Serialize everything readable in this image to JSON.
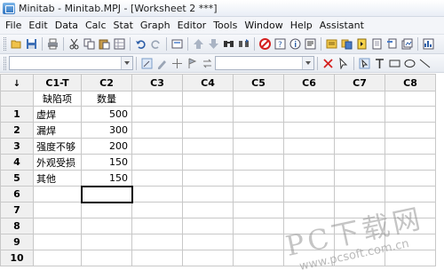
{
  "window": {
    "title": "Minitab - Minitab.MPJ - [Worksheet 2 ***]"
  },
  "menu": [
    {
      "label": "File"
    },
    {
      "label": "Edit"
    },
    {
      "label": "Data"
    },
    {
      "label": "Calc"
    },
    {
      "label": "Stat"
    },
    {
      "label": "Graph"
    },
    {
      "label": "Editor"
    },
    {
      "label": "Tools"
    },
    {
      "label": "Window"
    },
    {
      "label": "Help"
    },
    {
      "label": "Assistant"
    }
  ],
  "toolbar1_icons": [
    "open-icon",
    "save-icon",
    "print-icon",
    "cut-icon",
    "copy-icon",
    "paste-icon",
    "insert-cells-icon",
    "undo-icon",
    "redo-icon",
    "edit-last-dialog-icon",
    "move-up-icon",
    "move-down-icon",
    "find-icon",
    "find-next-icon",
    "cancel-icon",
    "help-icon",
    "info-icon",
    "session-window-icon",
    "worksheet-icon",
    "project-manager-icon",
    "report-pad-icon",
    "new-worksheet-icon",
    "tile-icon",
    "close-all-graphs-icon"
  ],
  "toolbar2_icons": [
    "brush-icon",
    "pen-icon",
    "crosshair-icon",
    "flag-icon",
    "refresh-icon",
    "delete-icon",
    "select-icon",
    "text-tool-icon",
    "rectangle-tool-icon",
    "ellipse-tool-icon",
    "line-tool-icon"
  ],
  "worksheet": {
    "corner_symbol": "↓",
    "columns": [
      "C1-T",
      "C2",
      "C3",
      "C4",
      "C5",
      "C6",
      "C7",
      "C8"
    ],
    "column_names": [
      "缺陷项",
      "数量",
      "",
      "",
      "",
      "",
      "",
      ""
    ],
    "rows": [
      {
        "num": "1",
        "c1": "虚焊",
        "c2": "500"
      },
      {
        "num": "2",
        "c1": "漏焊",
        "c2": "300"
      },
      {
        "num": "3",
        "c1": "强度不够",
        "c2": "200"
      },
      {
        "num": "4",
        "c1": "外观受损",
        "c2": "150"
      },
      {
        "num": "5",
        "c1": "其他",
        "c2": "150"
      },
      {
        "num": "6",
        "c1": "",
        "c2": ""
      },
      {
        "num": "7",
        "c1": "",
        "c2": ""
      },
      {
        "num": "8",
        "c1": "",
        "c2": ""
      },
      {
        "num": "9",
        "c1": "",
        "c2": ""
      },
      {
        "num": "10",
        "c1": "",
        "c2": ""
      }
    ]
  },
  "watermark": {
    "main": "PC下载网",
    "url": "www.pcsoft.com.cn"
  }
}
